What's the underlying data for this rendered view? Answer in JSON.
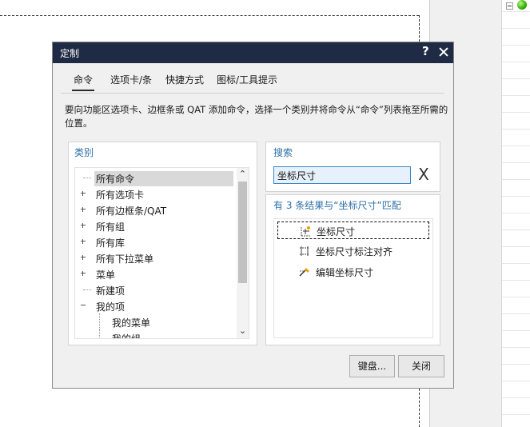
{
  "dialog": {
    "title": "定制",
    "help_label": "?",
    "tabs": [
      {
        "label": "命令",
        "active": true
      },
      {
        "label": "选项卡/条",
        "active": false
      },
      {
        "label": "快捷方式",
        "active": false
      },
      {
        "label": "图标/工具提示",
        "active": false
      }
    ],
    "description": "要向功能区选项卡、边框条或 QAT 添加命令，选择一个类别并将命令从“命令”列表拖至所需的位置。",
    "category": {
      "label": "类别",
      "items": [
        {
          "label": "所有命令",
          "expander": "none",
          "selected": true
        },
        {
          "label": "所有选项卡",
          "expander": "plus"
        },
        {
          "label": "所有边框条/QAT",
          "expander": "plus"
        },
        {
          "label": "所有组",
          "expander": "plus"
        },
        {
          "label": "所有库",
          "expander": "plus"
        },
        {
          "label": "所有下拉菜单",
          "expander": "plus"
        },
        {
          "label": "菜单",
          "expander": "plus"
        },
        {
          "label": "新建项",
          "expander": "none"
        },
        {
          "label": "我的项",
          "expander": "minus"
        },
        {
          "label": "我的菜单",
          "expander": "none",
          "child": true
        },
        {
          "label": "我的组",
          "expander": "none",
          "child": true
        }
      ]
    },
    "search": {
      "label": "搜索",
      "value": "坐标尺寸",
      "clear_label": "X"
    },
    "results": {
      "summary": "有 3 条结果与“坐标尺寸”匹配",
      "items": [
        {
          "label": "坐标尺寸",
          "icon": "ordinate-dimension-icon",
          "focused": true
        },
        {
          "label": "坐标尺寸标注对齐",
          "icon": "align-ordinate-icon",
          "focused": false
        },
        {
          "label": "编辑坐标尺寸",
          "icon": "edit-ordinate-icon",
          "focused": false
        }
      ]
    },
    "buttons": {
      "keyboard": "键盘...",
      "close": "关闭"
    }
  },
  "colors": {
    "title_bar": "#1f2a44",
    "group_label": "#2f6fa8",
    "search_border": "#3a86c6",
    "status_dot": "#2fb000"
  }
}
